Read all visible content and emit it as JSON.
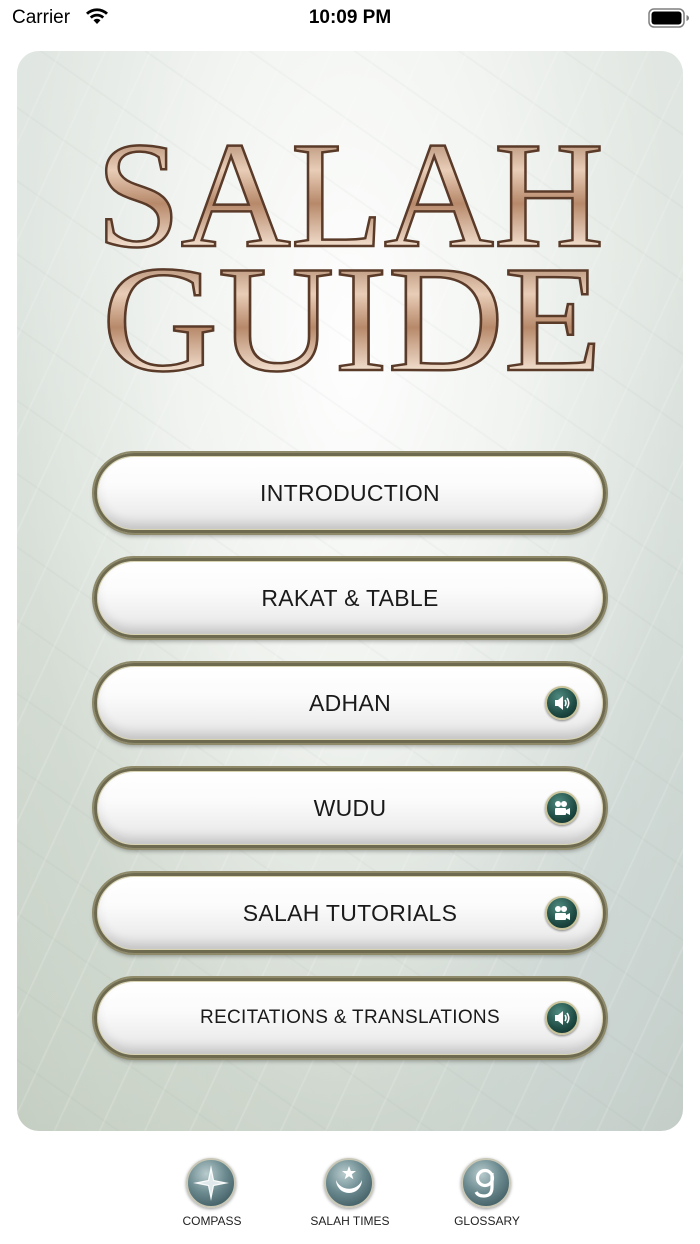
{
  "status_bar": {
    "carrier": "Carrier",
    "time": "10:09 PM"
  },
  "logo": {
    "line1": "SALAH",
    "line2": "GUIDE"
  },
  "menu": [
    {
      "label": "INTRODUCTION",
      "icon": null
    },
    {
      "label": "RAKAT & TABLE",
      "icon": null
    },
    {
      "label": "ADHAN",
      "icon": "speaker-icon"
    },
    {
      "label": "WUDU",
      "icon": "video-camera-icon"
    },
    {
      "label": "SALAH TUTORIALS",
      "icon": "video-camera-icon"
    },
    {
      "label": "RECITATIONS & TRANSLATIONS",
      "icon": "speaker-icon"
    }
  ],
  "tabs": [
    {
      "label": "COMPASS",
      "icon": "compass-icon"
    },
    {
      "label": "SALAH TIMES",
      "icon": "crescent-star-icon"
    },
    {
      "label": "GLOSSARY",
      "icon": "letter-g-icon"
    }
  ],
  "colors": {
    "accent": "#1e4b44",
    "button_border": "#6e6a4f",
    "logo_metal": "#b7896a"
  }
}
